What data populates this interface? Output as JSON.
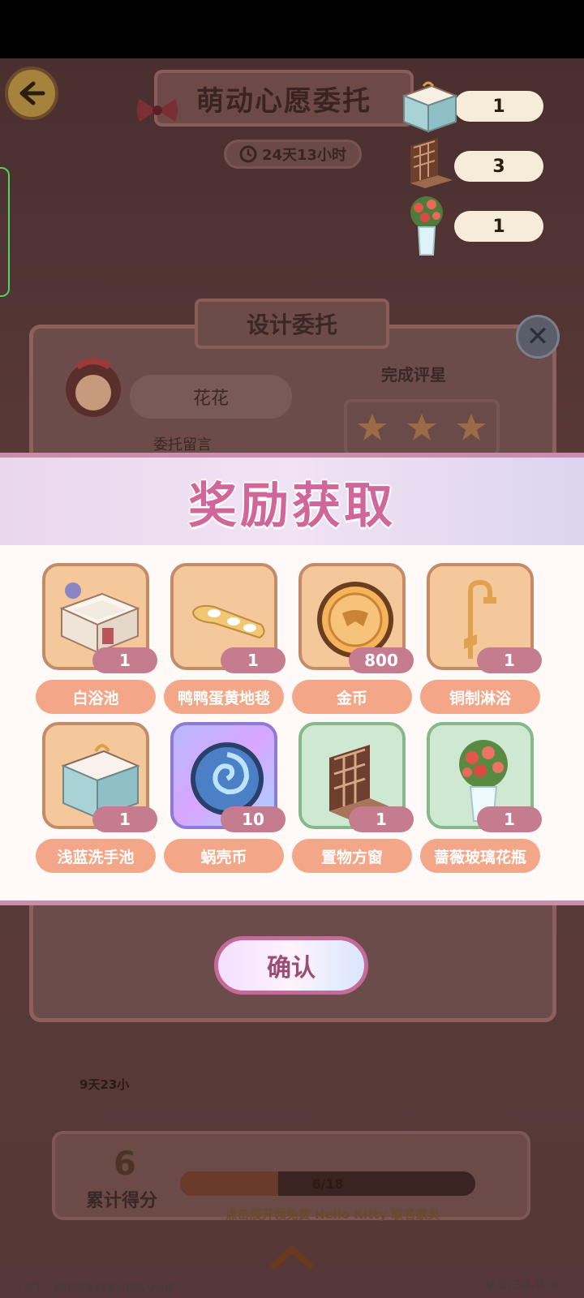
{
  "header": {
    "title": "萌动心愿委托",
    "timer": "24天13小时"
  },
  "counters": [
    {
      "icon": "washbasin-icon",
      "value": "1"
    },
    {
      "icon": "window-icon",
      "value": "3"
    },
    {
      "icon": "rose-vase-icon",
      "value": "1"
    }
  ],
  "dialog": {
    "title": "设计委托",
    "client_name": "花花",
    "rating_label": "完成评星",
    "message_label": "委托留言"
  },
  "reward": {
    "title": "奖励获取",
    "items": [
      {
        "name": "白浴池",
        "qty": "1",
        "icon": "bathtub-icon"
      },
      {
        "name": "鸭鸭蛋黄地毯",
        "qty": "1",
        "icon": "rug-icon"
      },
      {
        "name": "金币",
        "qty": "800",
        "icon": "gold-coin-icon"
      },
      {
        "name": "铜制淋浴",
        "qty": "1",
        "icon": "shower-icon"
      },
      {
        "name": "浅蓝洗手池",
        "qty": "1",
        "icon": "washbasin-icon"
      },
      {
        "name": "蜗壳币",
        "qty": "10",
        "icon": "snail-coin-icon"
      },
      {
        "name": "置物方窗",
        "qty": "1",
        "icon": "window-icon"
      },
      {
        "name": "蔷薇玻璃花瓶",
        "qty": "1",
        "icon": "rose-vase-icon"
      }
    ],
    "confirm_label": "确认"
  },
  "bottom": {
    "side_timer": "9天23小",
    "score_value": "6",
    "score_label": "累计得分",
    "progress_text": "6/18",
    "progress_ratio": 0.333,
    "promo": "点击展开领免费 Hello Kitty 联名家具"
  },
  "footer": {
    "id": "ID：WSKkHXnNKvbK",
    "version": "V.3.30.0_9"
  }
}
